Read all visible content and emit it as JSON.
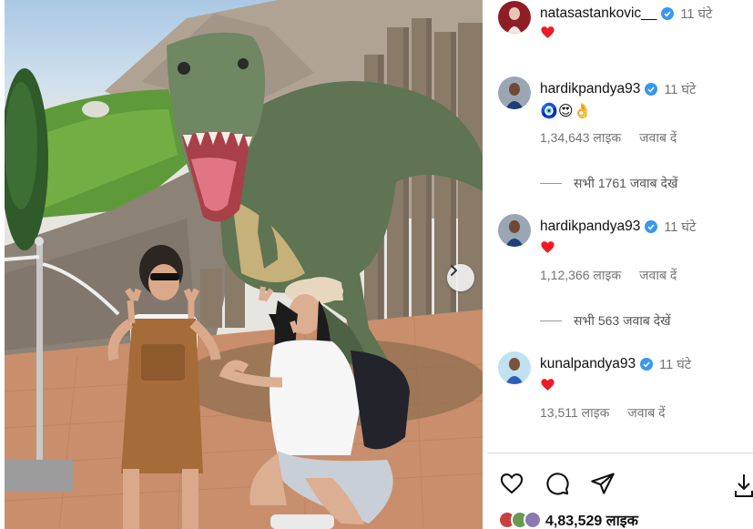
{
  "post": {
    "image_alt_subject": "child-woman-dinosaur-photo"
  },
  "comments": [
    {
      "username": "natasastankovic__",
      "time": "11 घंटे",
      "text": "",
      "likes": "",
      "reply": ""
    },
    {
      "username": "hardikpandya93",
      "time": "11 घंटे",
      "text": "🧿😍👌",
      "likes": "1,34,643 लाइक",
      "reply": "जवाब दें",
      "view_replies": "सभी 1761 जवाब देखें"
    },
    {
      "username": "hardikpandya93",
      "time": "11 घंटे",
      "text": "",
      "likes": "1,12,366 लाइक",
      "reply": "जवाब दें",
      "view_replies": "सभी 563 जवाब देखें"
    },
    {
      "username": "kunalpandya93",
      "time": "11 घंटे",
      "text": "",
      "likes": "13,511 लाइक",
      "reply": "जवाब दें"
    }
  ],
  "footer": {
    "likes_total": "4,83,529 लाइक"
  },
  "icons": [
    "heart-icon",
    "comment-icon",
    "share-icon",
    "save-icon",
    "verified-icon",
    "next-arrow-icon"
  ],
  "colors": {
    "verified": "#3897f0",
    "heart": "#ed1c24",
    "secondary_text": "#737373"
  }
}
